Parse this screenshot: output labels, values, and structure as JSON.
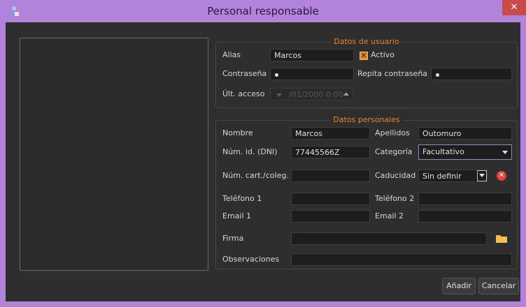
{
  "window": {
    "title": "Personal responsable",
    "icon": "user-icon",
    "close_glyph": "✕",
    "accent": "#b183db"
  },
  "datos_usuario": {
    "title": "Datos de usuario",
    "alias_label": "Alias",
    "alias_value": "Marcos",
    "activo_label": "Activo",
    "activo_checked": true,
    "password_label": "Contraseña",
    "repeat_password_label": "Repita contraseña",
    "last_access_label": "Últ. acceso",
    "last_access_value": "/01/2000 0:00"
  },
  "datos_personales": {
    "title": "Datos personales",
    "nombre_label": "Nombre",
    "nombre_value": "Marcos",
    "apellidos_label": "Apellidos",
    "apellidos_value": "Outomuro",
    "dni_label": "Núm. id. (DNI)",
    "dni_value": "77445566Z",
    "categoria_label": "Categoría",
    "categoria_value": "Facultativo",
    "cart_label": "Núm. cart./coleg.",
    "cart_value": "",
    "caducidad_label": "Caducidad",
    "caducidad_value": "Sin definir",
    "telefono1_label": "Teléfono 1",
    "telefono2_label": "Teléfono 2",
    "email1_label": "Email 1",
    "email2_label": "Email 2",
    "firma_label": "Firma",
    "observaciones_label": "Observaciones"
  },
  "buttons": {
    "add": "Añadir",
    "cancel": "Cancelar"
  },
  "colors": {
    "group_title": "#e9852b",
    "clear": "#e0463e",
    "folder": "#f2b43c"
  }
}
